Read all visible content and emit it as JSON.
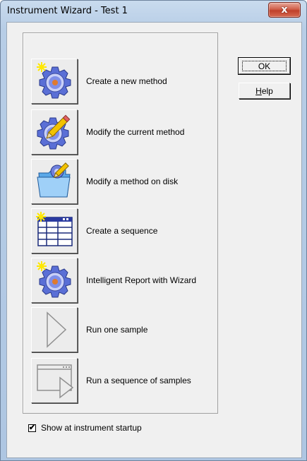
{
  "window": {
    "title": "Instrument Wizard - Test 1",
    "close_glyph": "x"
  },
  "wizard": {
    "items": [
      {
        "label": "Create a new method",
        "icon": "gear-sparkle-icon"
      },
      {
        "label": "Modify the current method",
        "icon": "gear-pencil-icon"
      },
      {
        "label": "Modify a method on disk",
        "icon": "folder-gear-icon"
      },
      {
        "label": "Create a sequence",
        "icon": "table-sparkle-icon"
      },
      {
        "label": "Intelligent Report with Wizard",
        "icon": "gear-sparkle-icon"
      },
      {
        "label": "Run one sample",
        "icon": "play-triangle-icon"
      },
      {
        "label": "Run a sequence of samples",
        "icon": "window-play-icon"
      }
    ]
  },
  "buttons": {
    "ok": {
      "label": "OK",
      "underline_char": "",
      "is_default": true
    },
    "help": {
      "label": "Help",
      "underline_char": "H"
    }
  },
  "startup": {
    "label": "Show at instrument startup",
    "checked": true,
    "check_glyph": "✔"
  },
  "colors": {
    "close_button": "#c94a33",
    "gear_blue": "#5a6fd6",
    "gear_center": "#e07a2e",
    "sparkle_yellow": "#ffe800"
  }
}
